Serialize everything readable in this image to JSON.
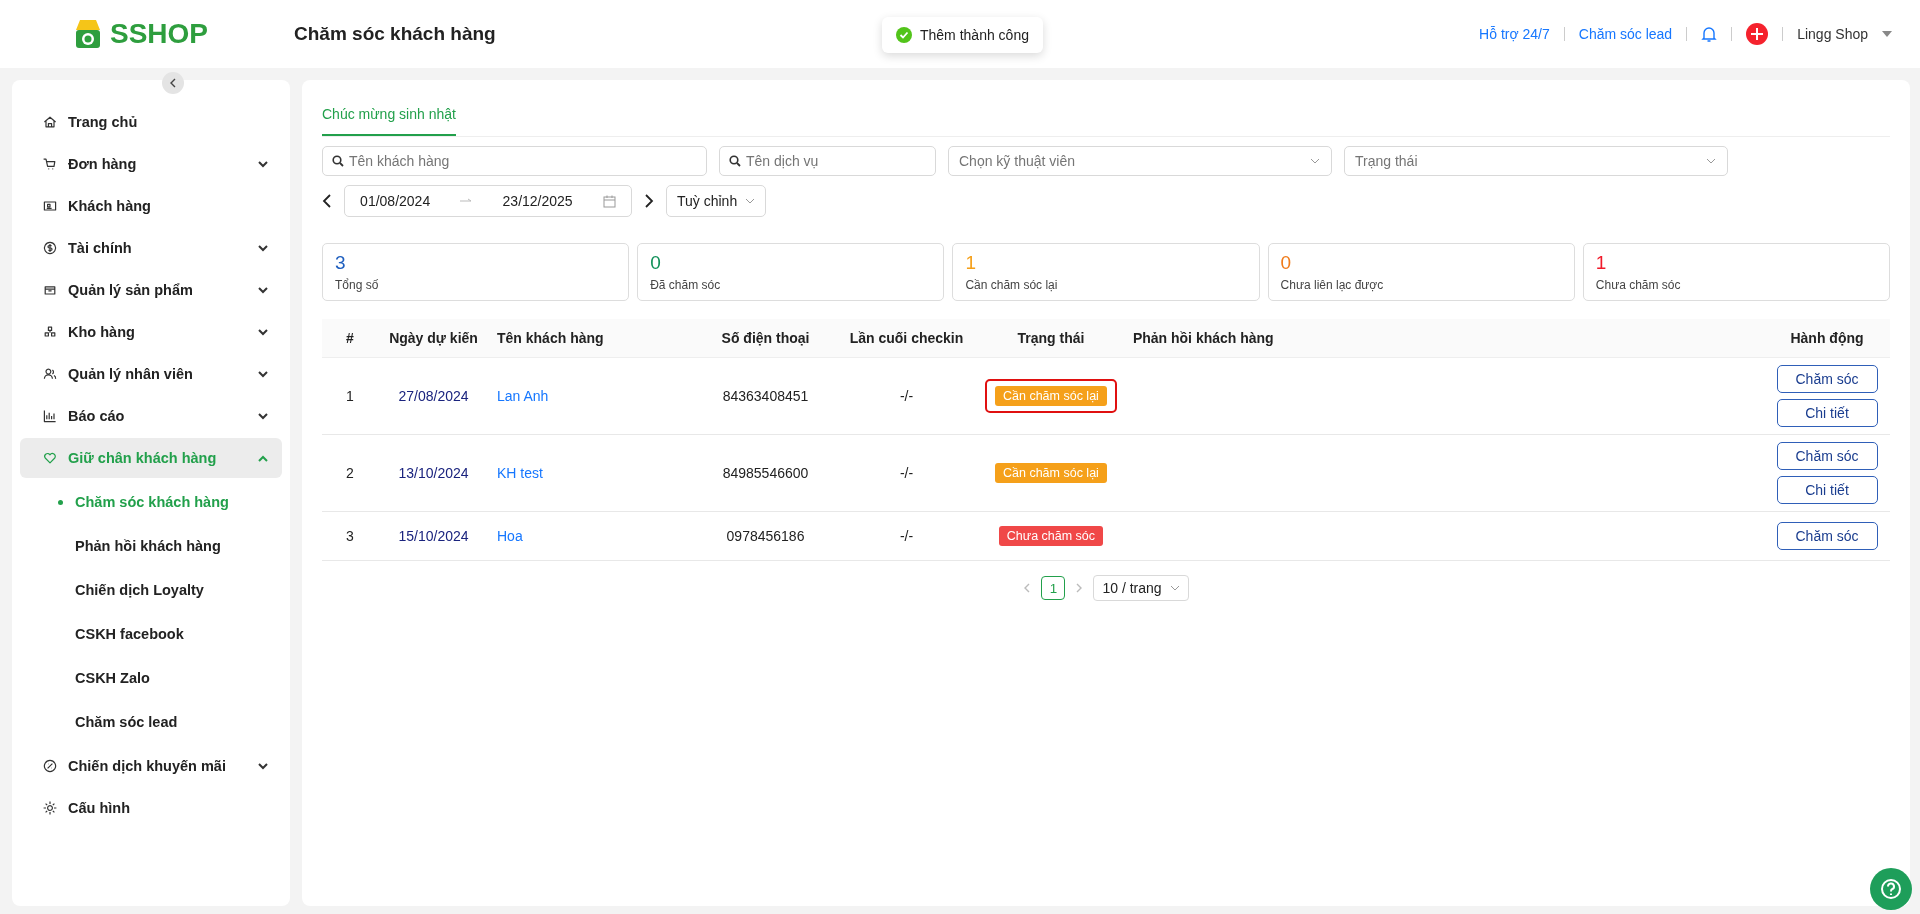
{
  "header": {
    "logo": "SSHOP",
    "title": "Chăm sóc khách hàng",
    "toast": "Thêm thành công",
    "links": [
      "Hỗ trợ 24/7",
      "Chăm sóc lead"
    ],
    "user": "Lingg Shop"
  },
  "sidebar": {
    "items": [
      {
        "label": "Trang chủ",
        "expandable": false,
        "selected": false
      },
      {
        "label": "Đơn hàng",
        "expandable": true,
        "expanded": false,
        "selected": false
      },
      {
        "label": "Khách hàng",
        "expandable": false,
        "selected": false
      },
      {
        "label": "Tài chính",
        "expandable": true,
        "expanded": false,
        "selected": false
      },
      {
        "label": "Quản lý sản phẩm",
        "expandable": true,
        "expanded": false,
        "selected": false
      },
      {
        "label": "Kho hàng",
        "expandable": true,
        "expanded": false,
        "selected": false
      },
      {
        "label": "Quản lý nhân viên",
        "expandable": true,
        "expanded": false,
        "selected": false
      },
      {
        "label": "Báo cáo",
        "expandable": true,
        "expanded": false,
        "selected": false
      },
      {
        "label": "Giữ chân khách hàng",
        "expandable": true,
        "expanded": true,
        "selected": true,
        "children": [
          {
            "label": "Chăm sóc khách hàng",
            "selected": true
          },
          {
            "label": "Phản hồi khách hàng",
            "selected": false
          },
          {
            "label": "Chiến dịch Loyalty",
            "selected": false
          },
          {
            "label": "CSKH facebook",
            "selected": false
          },
          {
            "label": "CSKH Zalo",
            "selected": false
          },
          {
            "label": "Chăm sóc lead",
            "selected": false
          }
        ]
      },
      {
        "label": "Chiến dịch khuyến mãi",
        "expandable": true,
        "expanded": false,
        "selected": false
      },
      {
        "label": "Cấu hình",
        "expandable": false,
        "selected": false
      }
    ]
  },
  "tabs": [
    {
      "label": "Chúc mừng sinh nhật",
      "selected": true
    }
  ],
  "filters": {
    "customer": {
      "placeholder": "Tên khách hàng"
    },
    "service": {
      "placeholder": "Tên dịch vụ"
    },
    "technician": {
      "placeholder": "Chọn kỹ thuật viên"
    },
    "status": {
      "placeholder": "Trạng thái"
    },
    "date_from": "01/08/2024",
    "date_to": "23/12/2025",
    "range": "Tuỳ chỉnh"
  },
  "stats": [
    {
      "value": "3",
      "label": "Tổng số",
      "color": "#1f5fbf"
    },
    {
      "value": "0",
      "label": "Đã chăm sóc",
      "color": "#12915a"
    },
    {
      "value": "1",
      "label": "Cần chăm sóc lại",
      "color": "#f5a01a"
    },
    {
      "value": "0",
      "label": "Chưa liên lạc được",
      "color": "#f07b1a"
    },
    {
      "value": "1",
      "label": "Chưa chăm sóc",
      "color": "#f01a2a"
    }
  ],
  "table": {
    "columns": [
      "#",
      "Ngày dự kiến",
      "Tên khách hàng",
      "Số điện thoại",
      "Lần cuối checkin",
      "Trạng thái",
      "Phản hồi khách hàng",
      "Hành động"
    ],
    "rows": [
      {
        "index": "1",
        "date": "27/08/2024",
        "name": "Lan Anh",
        "phone": "84363408451",
        "checkin": "-/-",
        "status": "Cần chăm sóc lại",
        "color": "#f5a01a",
        "highlighted": true,
        "actions": [
          "Chăm sóc",
          "Chi tiết"
        ]
      },
      {
        "index": "2",
        "date": "13/10/2024",
        "name": "KH test",
        "phone": "84985546600",
        "checkin": "-/-",
        "status": "Cần chăm sóc lại",
        "color": "#f5a01a",
        "highlighted": false,
        "actions": [
          "Chăm sóc",
          "Chi tiết"
        ]
      },
      {
        "index": "3",
        "date": "15/10/2024",
        "name": "Hoa",
        "phone": "0978456186",
        "checkin": "-/-",
        "status": "Chưa chăm sóc",
        "color": "#f04848",
        "highlighted": false,
        "actions": [
          "Chăm sóc"
        ]
      }
    ]
  },
  "pagination": {
    "pages": [
      {
        "label": "1",
        "selected": true
      }
    ],
    "page_size": "10 / trang"
  }
}
